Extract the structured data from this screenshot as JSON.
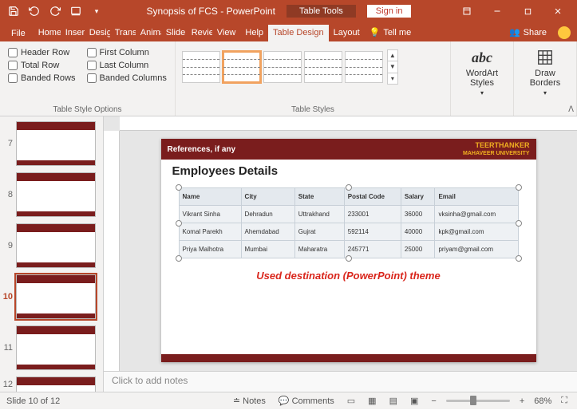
{
  "titlebar": {
    "doc_title": "Synopsis of FCS  -  PowerPoint",
    "context_tab": "Table Tools",
    "signin": "Sign in"
  },
  "tabs": {
    "file": "File",
    "home": "Home",
    "insert": "Insert",
    "design": "Design",
    "transitions": "Transitions",
    "animations": "Animations",
    "slideshow": "Slide Show",
    "review": "Review",
    "view": "View",
    "help": "Help",
    "table_design": "Table Design",
    "layout": "Layout",
    "tellme": "Tell me",
    "share": "Share"
  },
  "ribbon": {
    "style_options": {
      "header_row": "Header Row",
      "total_row": "Total Row",
      "banded_rows": "Banded Rows",
      "first_col": "First Column",
      "last_col": "Last Column",
      "banded_cols": "Banded Columns",
      "group_label": "Table Style Options"
    },
    "table_styles_label": "Table Styles",
    "wordart": "WordArt Styles",
    "draw_borders": "Draw Borders"
  },
  "thumbnails": [
    "7",
    "8",
    "9",
    "10",
    "11",
    "12"
  ],
  "active_slide_index": "10",
  "slide": {
    "ref_header": "References, if any",
    "university_top": "TEERTHANKER",
    "university_bot": "MAHAVEER UNIVERSITY",
    "title": "Employees Details",
    "caption": "Used destination (PowerPoint) theme",
    "headers": {
      "name": "Name",
      "city": "City",
      "state": "State",
      "postal": "Postal Code",
      "salary": "Salary",
      "email": "Email"
    },
    "rows": [
      {
        "name": "Vikrant Sinha",
        "city": "Dehradun",
        "state": "Uttrakhand",
        "postal": "233001",
        "salary": "36000",
        "email": "vksinha@gmail.com"
      },
      {
        "name": "Komal Parekh",
        "city": "Ahemdabad",
        "state": "Gujrat",
        "postal": "592114",
        "salary": "40000",
        "email": "kpk@gmail.com"
      },
      {
        "name": "Priya Malhotra",
        "city": "Mumbai",
        "state": "Maharatra",
        "postal": "245771",
        "salary": "25000",
        "email": "priyam@gmail.com"
      }
    ]
  },
  "notes_placeholder": "Click to add notes",
  "status": {
    "slide_counter": "Slide 10 of 12",
    "notes": "Notes",
    "comments": "Comments",
    "zoom_pct": "68%"
  }
}
